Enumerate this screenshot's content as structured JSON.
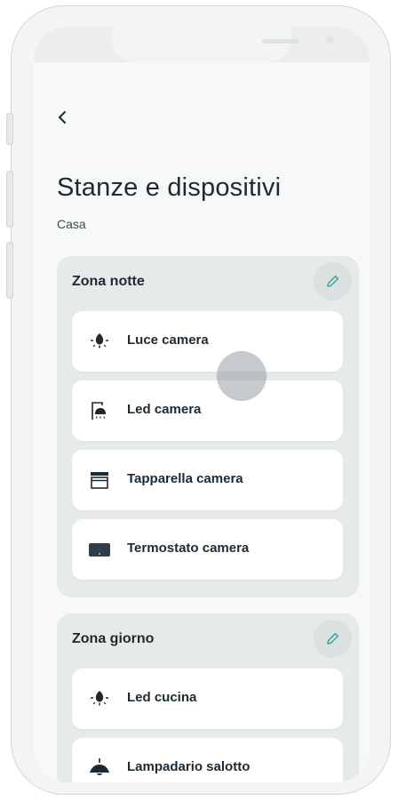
{
  "header": {
    "title": "Stanze e dispositivi",
    "subtitle": "Casa"
  },
  "zones": [
    {
      "name": "Zona notte",
      "devices": [
        {
          "label": "Luce camera",
          "icon": "bulb-icon"
        },
        {
          "label": "Led camera",
          "icon": "led-icon"
        },
        {
          "label": "Tapparella camera",
          "icon": "shutter-icon"
        },
        {
          "label": "Termostato camera",
          "icon": "thermostat-icon"
        }
      ]
    },
    {
      "name": "Zona giorno",
      "devices": [
        {
          "label": "Led cucina",
          "icon": "bulb-icon"
        },
        {
          "label": "Lampadario salotto",
          "icon": "chandelier-icon"
        }
      ]
    }
  ],
  "colors": {
    "accent": "#3aa59b",
    "zone_bg": "#e6eae9",
    "text": "#1d2a33"
  }
}
